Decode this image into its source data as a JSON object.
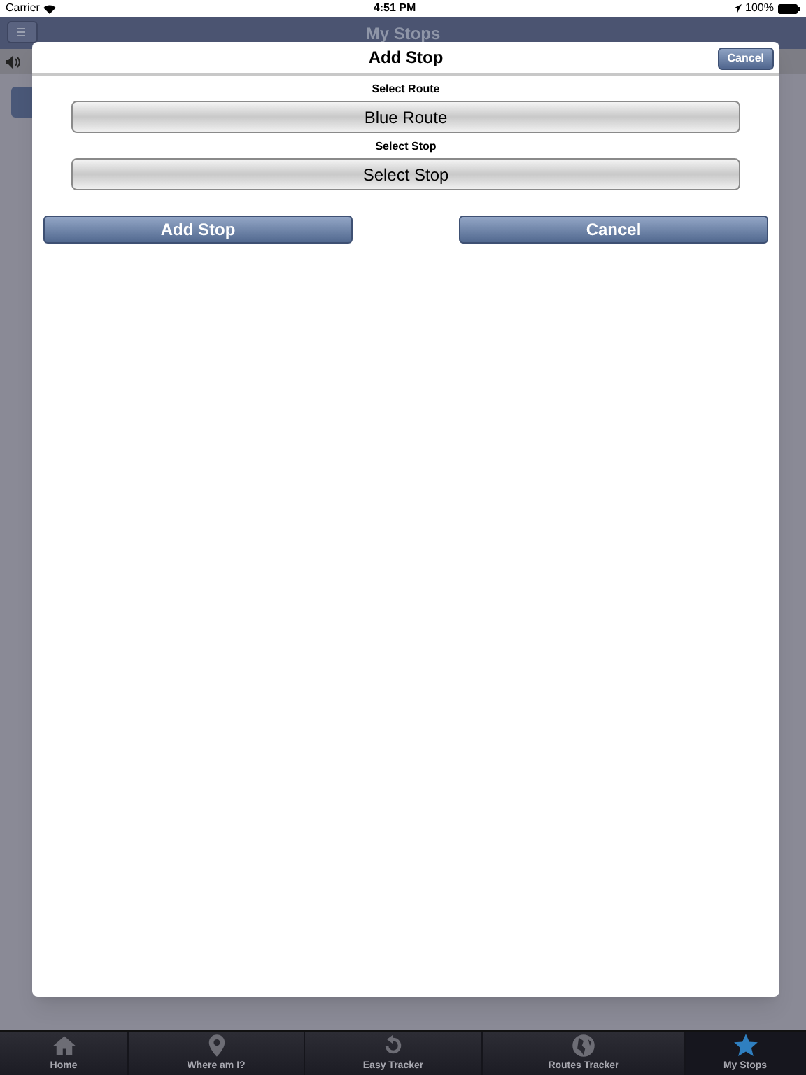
{
  "status_bar": {
    "carrier": "Carrier",
    "time": "4:51 PM",
    "battery": "100%"
  },
  "nav_bar": {
    "title": "My Stops"
  },
  "dialog": {
    "title": "Add Stop",
    "header_button": "Cancel",
    "fields": [
      {
        "label": "Select Route",
        "value": "Blue Route"
      },
      {
        "label": "Select Stop",
        "value": "Select Stop"
      }
    ],
    "buttons": [
      "Add Stop",
      "Cancel"
    ]
  },
  "tab_bar": [
    {
      "label": "Home",
      "selected": false
    },
    {
      "label": "Where am I?",
      "selected": false
    },
    {
      "label": "Easy Tracker",
      "selected": false
    },
    {
      "label": "Routes Tracker",
      "selected": false
    },
    {
      "label": "My Stops",
      "selected": true
    }
  ]
}
